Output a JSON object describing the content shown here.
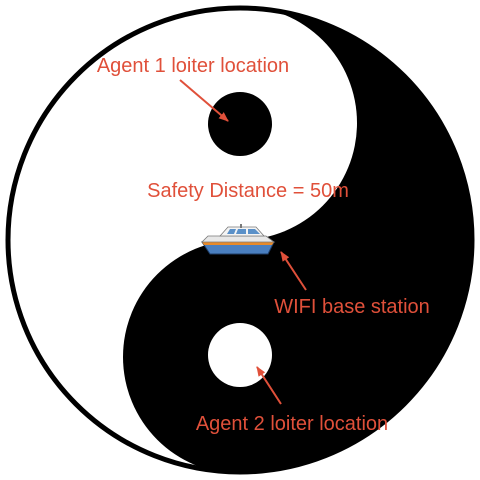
{
  "labels": {
    "agent1": "Agent 1 loiter location",
    "safety": "Safety Distance = 50m",
    "wifi": "WIFI base station",
    "agent2": "Agent 2 loiter location"
  },
  "colors": {
    "annotation": "#e0503a",
    "dark": "#000000",
    "light": "#ffffff",
    "boat_hull": "#4a7fc0",
    "boat_stripe": "#e88a2a",
    "boat_cabin": "#f4f4f4"
  },
  "icons": {
    "boat": "boat-icon"
  }
}
